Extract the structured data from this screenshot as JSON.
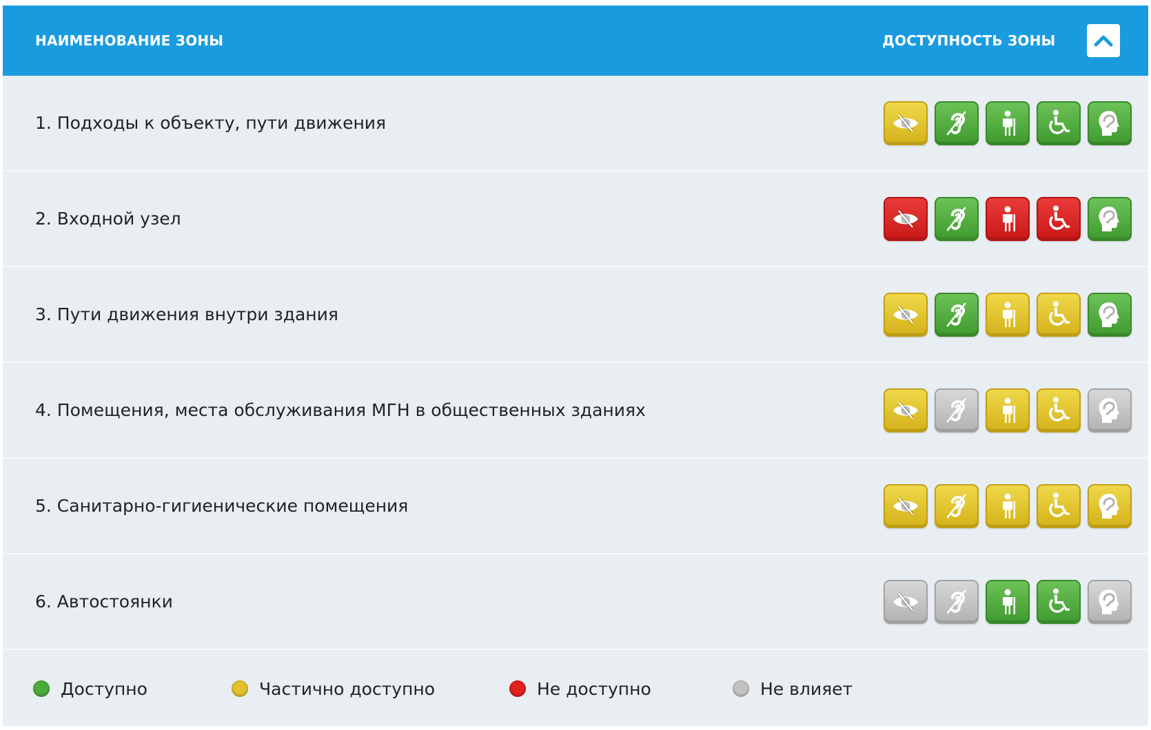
{
  "header": {
    "zone_name_label": "НАИМЕНОВАНИЕ ЗОНЫ",
    "zone_access_label": "ДОСТУПНОСТЬ ЗОНЫ",
    "collapse_icon": "chevron-up-icon"
  },
  "categories": [
    "vision",
    "hearing",
    "mobility",
    "wheelchair",
    "cognitive"
  ],
  "category_icons": [
    "eye-icon",
    "ear-icon",
    "person-icon",
    "wheelchair-icon",
    "head-icon"
  ],
  "statuses": {
    "g": {
      "label": "Доступно",
      "color": "#4aab3a"
    },
    "y": {
      "label": "Частично доступно",
      "color": "#e2c12c"
    },
    "r": {
      "label": "Не доступно",
      "color": "#e22020"
    },
    "n": {
      "label": "Не влияет",
      "color": "#c2c2c2"
    }
  },
  "zones": [
    {
      "name": "1. Подходы к объекту, пути движения",
      "status": [
        "y",
        "g",
        "g",
        "g",
        "g"
      ]
    },
    {
      "name": "2. Входной узел",
      "status": [
        "r",
        "g",
        "r",
        "r",
        "g"
      ]
    },
    {
      "name": "3. Пути движения внутри здания",
      "status": [
        "y",
        "g",
        "y",
        "y",
        "g"
      ]
    },
    {
      "name": "4. Помещения, места обслуживания МГН в общественных зданиях",
      "status": [
        "y",
        "n",
        "y",
        "y",
        "n"
      ]
    },
    {
      "name": "5. Санитарно-гигиенические помещения",
      "status": [
        "y",
        "y",
        "y",
        "y",
        "y"
      ]
    },
    {
      "name": "6. Автостоянки",
      "status": [
        "n",
        "n",
        "g",
        "g",
        "n"
      ]
    }
  ],
  "legend": [
    {
      "key": "g",
      "label": "Доступно"
    },
    {
      "key": "y",
      "label": "Частично доступно"
    },
    {
      "key": "r",
      "label": "Не доступно"
    },
    {
      "key": "n",
      "label": "Не влияет"
    }
  ]
}
